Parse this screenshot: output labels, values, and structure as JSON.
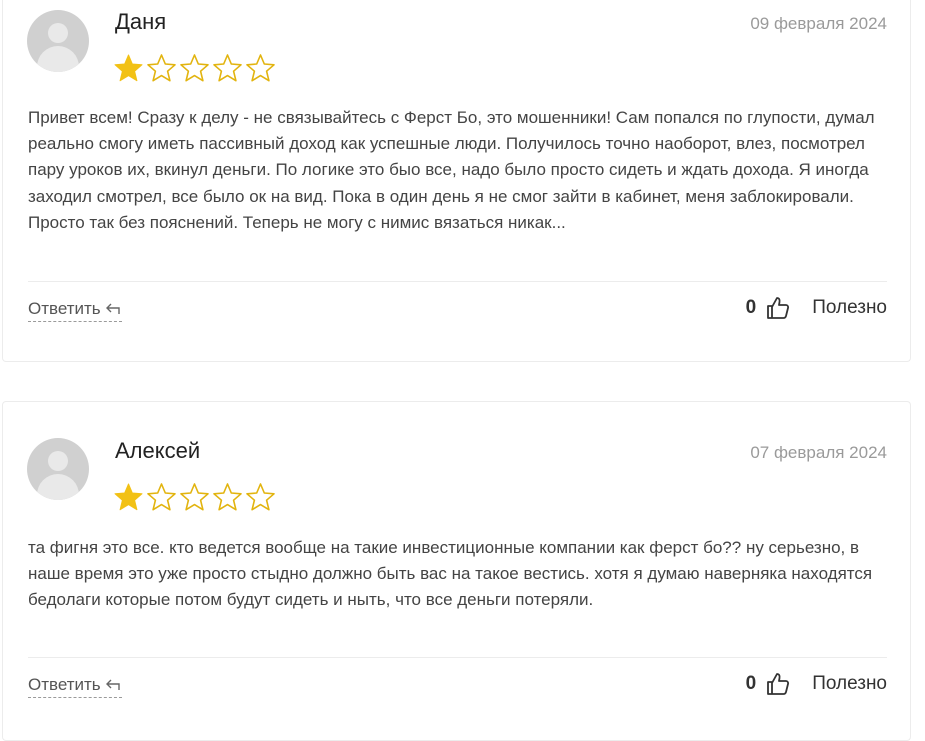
{
  "reviews": [
    {
      "author": "Даня",
      "date": "09 февраля 2024",
      "rating": 1,
      "max_rating": 5,
      "text": "Привет всем! Сразу к делу - не связывайтесь с Ферст Бо, это мошенники! Сам попался по глупости, думал реально смогу иметь пассивный доход как успешные люди. Получилось точно наоборот, влез, посмотрел пару уроков их, вкинул деньги. По логике это быо все, надо было просто сидеть и ждать дохода. Я иногда заходил смотрел, все было ок на вид. Пока в один день я не смог зайти в кабинет, меня заблокировали. Просто так без пояснений. Теперь не могу с нимис вязаться никак...",
      "reply_label": "Ответить",
      "useful_count": "0",
      "useful_label": "Полезно"
    },
    {
      "author": "Алексей",
      "date": "07 февраля 2024",
      "rating": 1,
      "max_rating": 5,
      "text": "та фигня это все. кто ведется вообще на такие инвестиционные компании как ферст бо?? ну серьезно, в наше время это уже просто стыдно должно быть вас на такое вестись. хотя я думаю наверняка находятся бедолаги которые потом будут сидеть и ныть, что все деньги потеряли.",
      "reply_label": "Ответить",
      "useful_count": "0",
      "useful_label": "Полезно"
    }
  ],
  "colors": {
    "star_filled": "#f2c115",
    "star_empty": "#e2b40f"
  },
  "icons": {
    "reply": "reply-arrow-icon",
    "like": "thumbs-up-icon",
    "avatar": "user-placeholder-icon"
  }
}
